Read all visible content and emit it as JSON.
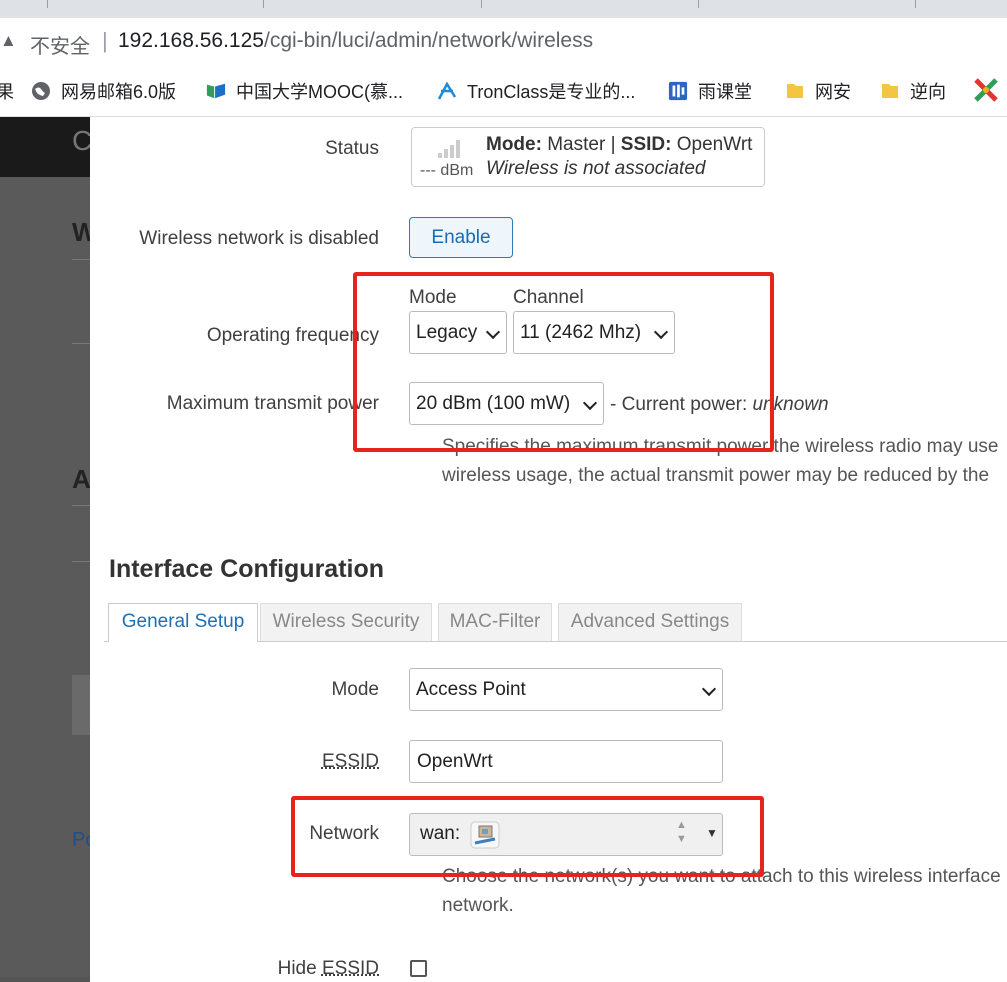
{
  "browser": {
    "security_label": "不安全",
    "url_host": "192.168.56.125",
    "url_path": "/cgi-bin/luci/admin/network/wireless",
    "bookmarks": [
      {
        "label": "网易邮箱6.0版",
        "icon": "globe-icon"
      },
      {
        "label": "中国大学MOOC(慕...",
        "icon": "mooc-icon"
      },
      {
        "label": "TronClass是专业的...",
        "icon": "tronclass-icon"
      },
      {
        "label": "雨课堂",
        "icon": "rain-classroom-icon"
      },
      {
        "label": "网安",
        "icon": "folder-icon"
      },
      {
        "label": "逆向",
        "icon": "folder-icon"
      }
    ],
    "bookmark_cutoff_left": "果"
  },
  "backdrop": {
    "header_letter": "C",
    "heading_w": "W",
    "heading_a": "A",
    "link_po": "Po"
  },
  "device": {
    "status_label": "Status",
    "signal_dbm": "--- dBm",
    "mode_key": "Mode:",
    "mode_value": "Master",
    "ssid_key": "SSID:",
    "ssid_value": "OpenWrt",
    "assoc_status": "Wireless is not associated",
    "disabled_label": "Wireless network is disabled",
    "enable_label": "Enable",
    "freq_label": "Operating frequency",
    "mode_sublabel": "Mode",
    "channel_sublabel": "Channel",
    "mode_selected": "Legacy",
    "channel_selected": "11 (2462 Mhz)",
    "txpower_label": "Maximum transmit power",
    "txpower_selected": "20 dBm (100 mW)",
    "current_power_prefix": "- Current power: ",
    "current_power_value": "unknown",
    "txpower_help_1": "Specifies the maximum transmit power the wireless radio may use",
    "txpower_help_2": "wireless usage, the actual transmit power may be reduced by the"
  },
  "interface": {
    "section_title": "Interface Configuration",
    "tabs": [
      "General Setup",
      "Wireless Security",
      "MAC-Filter",
      "Advanced Settings"
    ],
    "mode_label": "Mode",
    "mode_selected": "Access Point",
    "essid_label": "ESSID",
    "essid_value": "OpenWrt",
    "network_label": "Network",
    "network_value": "wan:",
    "network_help_1": "Choose the network(s) you want to attach to this wireless interface",
    "network_help_2": "network.",
    "hide_essid_prefix": "Hide ",
    "hide_essid_word": "ESSID"
  },
  "colors": {
    "annotation_red": "#e8231c",
    "link_blue": "#1f6fb6"
  }
}
